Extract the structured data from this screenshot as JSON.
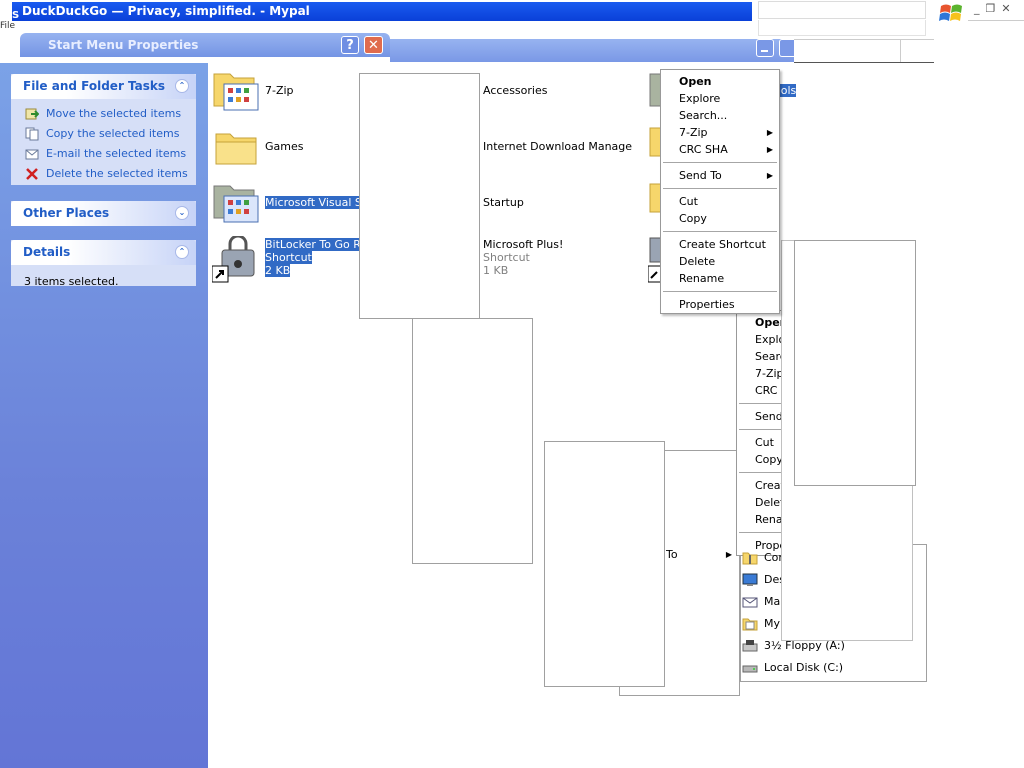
{
  "browser": {
    "title": "DuckDuckGo — Privacy, simplified. - Mypal",
    "menu_fragment": "File"
  },
  "dialog": {
    "title": "Start Menu Properties",
    "help_label": "?",
    "close_label": "✕"
  },
  "task_pane": {
    "file_tasks": {
      "title": "File and Folder Tasks",
      "items": [
        {
          "label": "Move the selected items"
        },
        {
          "label": "Copy the selected items"
        },
        {
          "label": "E-mail the selected items"
        },
        {
          "label": "Delete the selected items"
        }
      ]
    },
    "other_places": {
      "title": "Other Places"
    },
    "details": {
      "title": "Details",
      "text": "3 items selected."
    }
  },
  "files": [
    {
      "name": "7-Zip",
      "icon": "program-folder-icon"
    },
    {
      "name": "Accessories",
      "icon": "folder-icon"
    },
    {
      "name": "Games",
      "icon": "folder-icon"
    },
    {
      "name": "Internet Download Manager",
      "icon": "folder-icon"
    },
    {
      "name": "Microsoft Visual Stu",
      "icon": "program-folder-icon"
    },
    {
      "name": "Startup",
      "icon": "folder-icon"
    },
    {
      "name": "BitLocker To Go Rea",
      "type": "Shortcut",
      "size": "2 KB",
      "icon": "bitlocker-shortcut-icon"
    },
    {
      "name": "Microsoft Plus!",
      "type": "Shortcut",
      "size": "1 KB",
      "icon": "shortcut-icon"
    },
    {
      "name": "ools",
      "icon": "program-folder-icon"
    }
  ],
  "context_menu": {
    "items": [
      "Open",
      "Explore",
      "Search...",
      "7-Zip",
      "CRC SHA",
      "Send To",
      "Cut",
      "Copy",
      "Create Shortcut",
      "Delete",
      "Rename",
      "Properties"
    ]
  },
  "context_menu_2": {
    "items": [
      "Open",
      "Explo",
      "Searc",
      "7-Zip",
      "CRC S",
      "Send",
      "Cut",
      "Copy",
      "Creat",
      "Delete",
      "Renam",
      "Properti"
    ]
  },
  "send_to_label": "To",
  "send_to": [
    {
      "label": "Comp",
      "icon": "compressed-folder-icon"
    },
    {
      "label": "Deskt",
      "icon": "desktop-icon"
    },
    {
      "label": "Mail R",
      "icon": "mail-recipient-icon"
    },
    {
      "label": "My Do",
      "icon": "my-documents-icon"
    },
    {
      "label": "3½ Floppy (A:)",
      "icon": "floppy-drive-icon"
    },
    {
      "label": "Local Disk (C:)",
      "icon": "hard-disk-icon"
    }
  ]
}
